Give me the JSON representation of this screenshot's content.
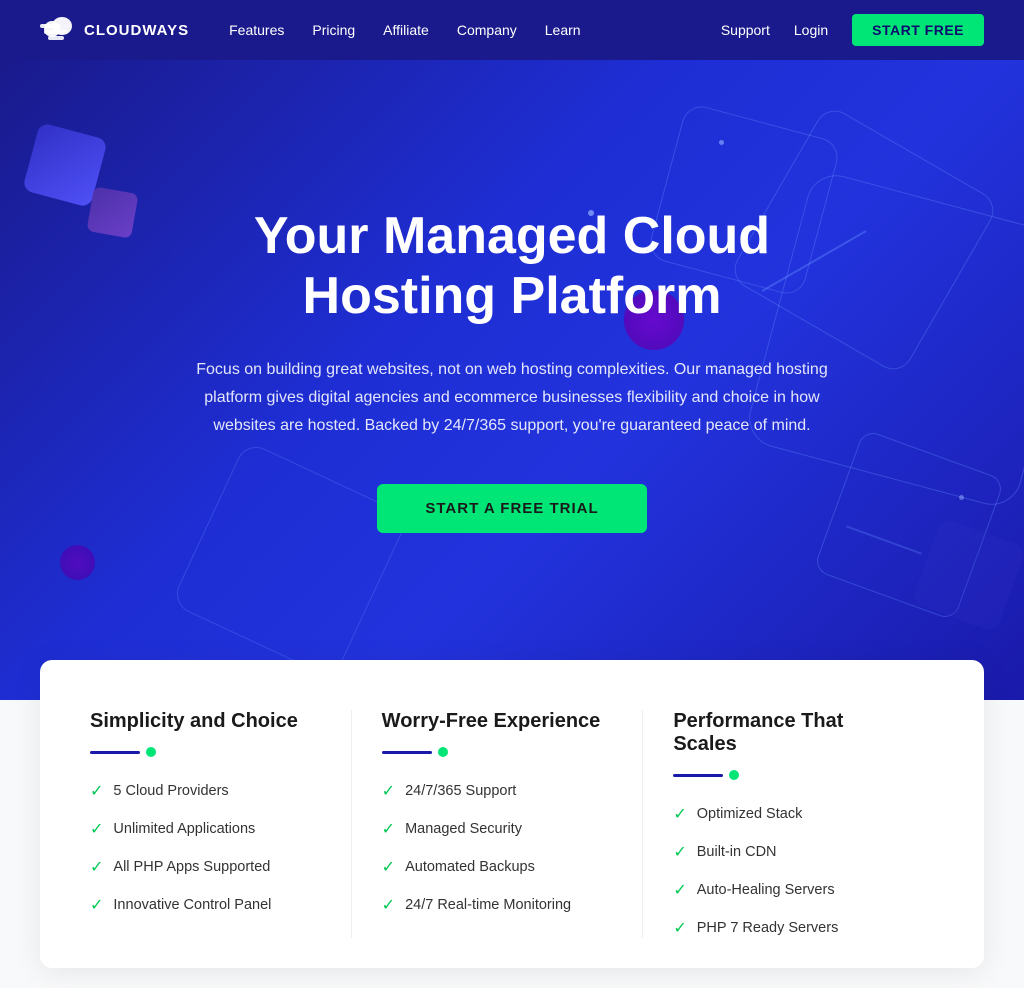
{
  "brand": {
    "name": "CLOUDWAYS"
  },
  "navbar": {
    "links": [
      {
        "label": "Features",
        "id": "features"
      },
      {
        "label": "Pricing",
        "id": "pricing"
      },
      {
        "label": "Affiliate",
        "id": "affiliate"
      },
      {
        "label": "Company",
        "id": "company"
      },
      {
        "label": "Learn",
        "id": "learn"
      }
    ],
    "right_links": [
      {
        "label": "Support",
        "id": "support"
      },
      {
        "label": "Login",
        "id": "login"
      }
    ],
    "cta_label": "START FREE"
  },
  "hero": {
    "title": "Your Managed Cloud Hosting Platform",
    "subtitle": "Focus on building great websites, not on web hosting complexities. Our managed hosting platform gives digital agencies and ecommerce businesses flexibility and choice in how websites are hosted. Backed by 24/7/365 support, you're guaranteed peace of mind.",
    "cta_label": "START A FREE TRIAL"
  },
  "features": {
    "columns": [
      {
        "id": "simplicity",
        "heading": "Simplicity and Choice",
        "items": [
          "5 Cloud Providers",
          "Unlimited Applications",
          "All PHP Apps Supported",
          "Innovative Control Panel"
        ]
      },
      {
        "id": "worry-free",
        "heading": "Worry-Free Experience",
        "items": [
          "24/7/365 Support",
          "Managed Security",
          "Automated Backups",
          "24/7 Real-time Monitoring"
        ]
      },
      {
        "id": "performance",
        "heading": "Performance That Scales",
        "items": [
          "Optimized Stack",
          "Built-in CDN",
          "Auto-Healing Servers",
          "PHP 7 Ready Servers"
        ]
      }
    ]
  }
}
